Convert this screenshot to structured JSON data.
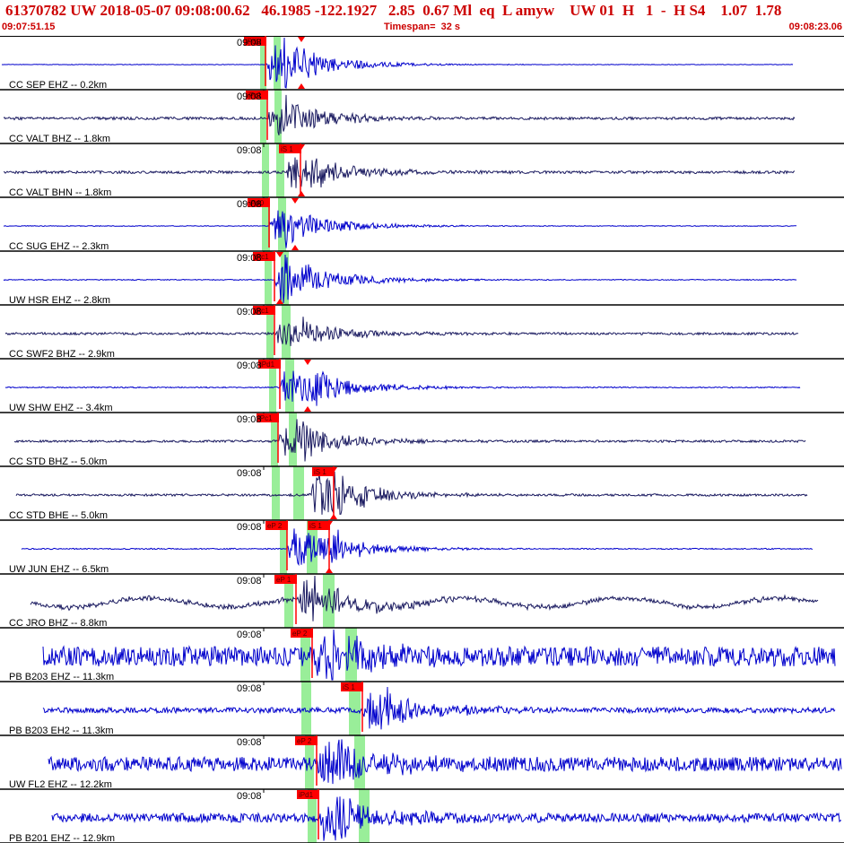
{
  "header": {
    "title": "61370782 UW 2018-05-07 09:08:00.62   46.1985 -122.1927   2.85  0.67 Ml  eq  L amyw    UW 01  H   1  -  H S4    1.07  1.78",
    "start_time": "09:07:51.15",
    "timespan": "Timespan=  32 s",
    "end_time": "09:08:23.06"
  },
  "colors": {
    "pick_red": "#ff0000",
    "green_band": "#99ee99",
    "trace_blue": "#0000cc",
    "trace_navy": "#1a1a60",
    "divider": "#000000"
  },
  "chart_data": {
    "type": "line",
    "title": "",
    "xlabel": "",
    "ylabel": "",
    "time_span_s": 32,
    "series": [
      {
        "label": "CC SEP EHZ -- 0.2km",
        "time": "09:08",
        "color": "#0000cc",
        "picks": [
          {
            "label": "iPdU"
          }
        ]
      },
      {
        "label": "CC VALT BHZ -- 1.8km",
        "time": "09:08",
        "color": "#1a1a60",
        "picks": [
          {
            "label": "iPc1"
          }
        ]
      },
      {
        "label": "CC VALT BHN -- 1.8km",
        "time": "09:08",
        "color": "#1a1a60",
        "picks": [
          {
            "label": "iS 1"
          }
        ]
      },
      {
        "label": "CC SUG EHZ -- 2.3km",
        "time": "09:08",
        "color": "#0000cc",
        "picks": [
          {
            "label": "iPd0"
          }
        ]
      },
      {
        "label": "UW HSR EHZ -- 2.8km",
        "time": "09:08",
        "color": "#0000cc",
        "picks": [
          {
            "label": "iPc1"
          }
        ]
      },
      {
        "label": "CC SWF2 BHZ -- 2.9km",
        "time": "09:08",
        "color": "#1a1a60",
        "picks": [
          {
            "label": "iPc1"
          }
        ]
      },
      {
        "label": "UW SHW EHZ -- 3.4km",
        "time": "09:08",
        "color": "#0000cc",
        "picks": [
          {
            "label": "iPd1"
          }
        ]
      },
      {
        "label": "CC STD BHZ -- 5.0km",
        "time": "09:08",
        "color": "#1a1a60",
        "picks": [
          {
            "label": "iPc1"
          }
        ]
      },
      {
        "label": "CC STD BHE -- 5.0km",
        "time": "09:08",
        "color": "#1a1a60",
        "picks": [
          {
            "label": "iS 1"
          }
        ]
      },
      {
        "label": "UW JUN EHZ -- 6.5km",
        "time": "09:08",
        "color": "#0000cc",
        "picks": [
          {
            "label": "eP 2"
          },
          {
            "label": "iS 1"
          }
        ]
      },
      {
        "label": "CC JRO BHZ -- 8.8km",
        "time": "09:08",
        "color": "#1a1a60",
        "picks": [
          {
            "label": "eP 1"
          }
        ]
      },
      {
        "label": "PB B203 EHZ -- 11.3km",
        "time": "09:08",
        "color": "#0000cc",
        "picks": [
          {
            "label": "eP 2"
          }
        ]
      },
      {
        "label": "PB B203 EH2 -- 11.3km",
        "time": "09:08",
        "color": "#0000cc",
        "picks": [
          {
            "label": "iS 1"
          }
        ]
      },
      {
        "label": "UW FL2 EHZ -- 12.2km",
        "time": "09:08",
        "color": "#0000cc",
        "picks": [
          {
            "label": "eP 2"
          }
        ]
      },
      {
        "label": "PB B201 EHZ -- 12.9km",
        "time": "09:08",
        "color": "#0000cc",
        "picks": [
          {
            "label": "iPd1"
          }
        ]
      }
    ]
  }
}
